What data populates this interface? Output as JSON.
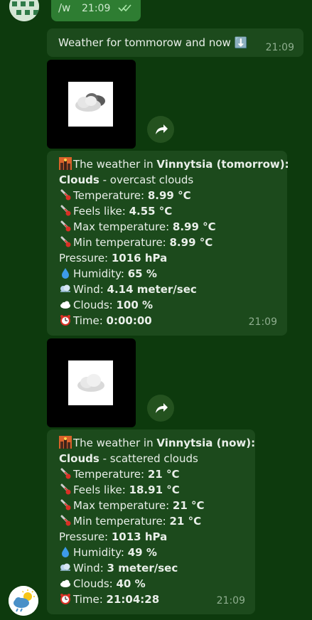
{
  "outgoing": {
    "text": "/w",
    "time": "21:09"
  },
  "header_message": {
    "text": "Weather for tommorow and now ⬇️",
    "time": "21:09"
  },
  "forecast_tomorrow": {
    "title_prefix": "The weather in ",
    "title_bold": "Vinnytsia (tomorrow)",
    "title_suffix": ":",
    "cond_bold": "Clouds",
    "cond_rest": " - overcast clouds",
    "temp_label": "Temperature: ",
    "temp": "8.99 °C",
    "feels_label": "Feels like: ",
    "feels": "4.55 °C",
    "max_label": "Max temperature: ",
    "max": "8.99 °C",
    "min_label": "Min temperature: ",
    "min": "8.99 °C",
    "pressure_label": "Pressure: ",
    "pressure": "1016 hPa",
    "humidity_label": "Humidity: ",
    "humidity": "65 %",
    "wind_label": "Wind: ",
    "wind": "4.14 meter/sec",
    "clouds_label": "Clouds: ",
    "clouds": "100 %",
    "time_label": "Time: ",
    "time_val": "0:00:00",
    "time": "21:09"
  },
  "forecast_now": {
    "title_prefix": "The weather in ",
    "title_bold": "Vinnytsia (now)",
    "title_suffix": ":",
    "cond_bold": "Clouds",
    "cond_rest": " - scattered clouds",
    "temp_label": "Temperature: ",
    "temp": "21 °C",
    "feels_label": "Feels like: ",
    "feels": "18.91 °C",
    "max_label": "Max temperature: ",
    "max": "21 °C",
    "min_label": "Min temperature: ",
    "min": "21 °C",
    "pressure_label": "Pressure: ",
    "pressure": "1013 hPa",
    "humidity_label": "Humidity: ",
    "humidity": "49 %",
    "wind_label": "Wind: ",
    "wind": "3 meter/sec",
    "clouds_label": "Clouds: ",
    "clouds": "40 %",
    "time_label": "Time: ",
    "time_val": "21:04:28",
    "time": "21:09"
  },
  "colors": {
    "background": "#0d3a0d",
    "bubble": "#1c4a1c",
    "outgoing": "#2e7d32"
  }
}
